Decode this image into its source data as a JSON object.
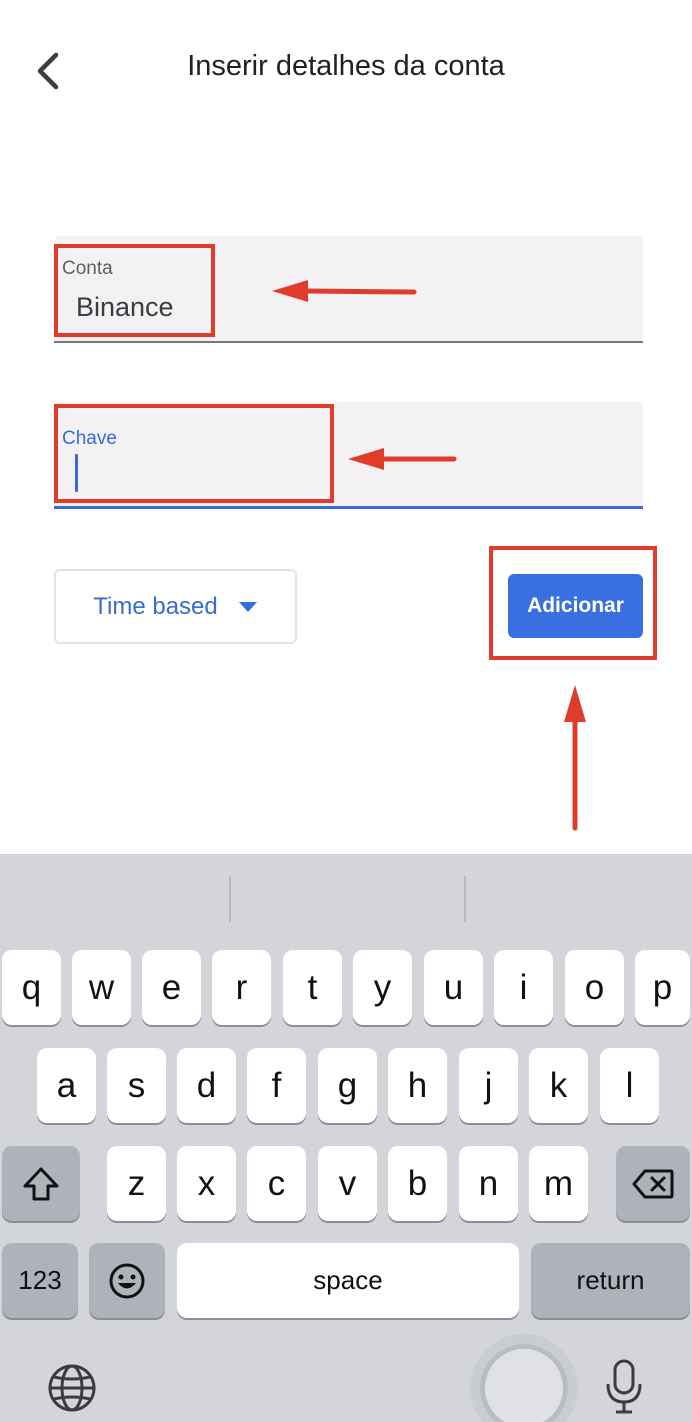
{
  "header": {
    "title": "Inserir detalhes da conta",
    "back_icon": "chevron-left-icon"
  },
  "form": {
    "account": {
      "label": "Conta",
      "value": "Binance"
    },
    "key": {
      "label": "Chave",
      "value": ""
    },
    "type_select": {
      "selected": "Time based",
      "icon": "caret-down-icon"
    },
    "add_button": {
      "label": "Adicionar"
    }
  },
  "annotations": {
    "color": "#e03c2c"
  },
  "keyboard": {
    "row1": [
      "q",
      "w",
      "e",
      "r",
      "t",
      "y",
      "u",
      "i",
      "o",
      "p"
    ],
    "row2": [
      "a",
      "s",
      "d",
      "f",
      "g",
      "h",
      "j",
      "k",
      "l"
    ],
    "row3": [
      "z",
      "x",
      "c",
      "v",
      "b",
      "n",
      "m"
    ],
    "numbers_key": "123",
    "space_key": "space",
    "return_key": "return",
    "icons": [
      "shift-icon",
      "backspace-icon",
      "emoji-icon",
      "globe-icon",
      "microphone-icon"
    ]
  },
  "colors": {
    "accent": "#3a6bd4",
    "button": "#3a6fe0",
    "keyboard_bg": "#d3d5db"
  }
}
